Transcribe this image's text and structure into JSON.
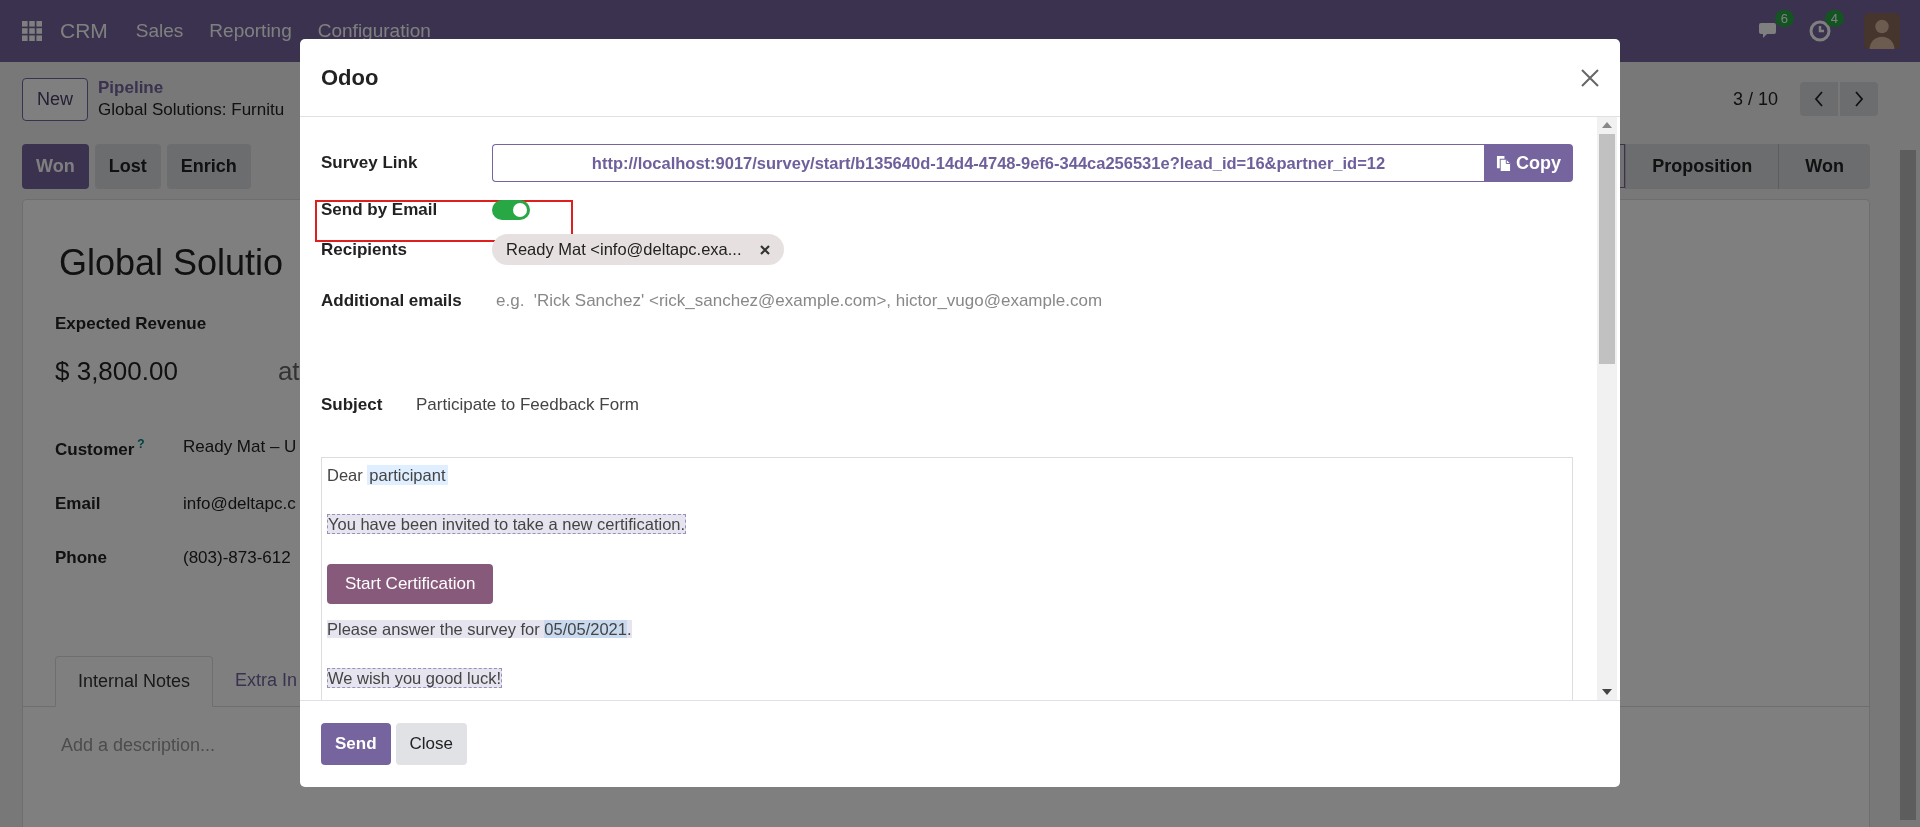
{
  "navbar": {
    "app": "CRM",
    "menus": [
      "Sales",
      "Reporting",
      "Configuration"
    ],
    "messages_count": "6",
    "activities_count": "4"
  },
  "control_panel": {
    "new_button": "New",
    "breadcrumb": "Pipeline",
    "record_title": "Global Solutions: Furnitu",
    "pager": "3 / 10"
  },
  "actions": [
    {
      "label": "Won",
      "primary": true
    },
    {
      "label": "Lost",
      "primary": false
    },
    {
      "label": "Enrich",
      "primary": false
    }
  ],
  "stages": [
    {
      "label": "Proposition",
      "selected": false
    },
    {
      "label": "Won",
      "selected": false
    }
  ],
  "record": {
    "title": "Global Solutio",
    "revenue_label": "Expected Revenue",
    "revenue": "$ 3,800.00",
    "revenue_suffix": "at",
    "fields": [
      {
        "label": "Customer",
        "help": "?",
        "value": "Ready Mat – U"
      },
      {
        "label": "Email",
        "value": "info@deltapc.c"
      },
      {
        "label": "Phone",
        "value": "(803)-873-612"
      }
    ],
    "tabs": [
      {
        "label": "Internal Notes",
        "selected": true
      },
      {
        "label": "Extra In",
        "selected": false
      }
    ],
    "description_placeholder": "Add a description..."
  },
  "dialog": {
    "title": "Odoo",
    "survey_link": {
      "label": "Survey Link",
      "value": "http://localhost:9017/survey/start/b135640d-14d4-4748-9ef6-344ca256531e?lead_id=16&partner_id=12",
      "copy": "Copy"
    },
    "send_by_email": {
      "label": "Send by Email",
      "on": true
    },
    "recipients": {
      "label": "Recipients",
      "tags": [
        "Ready Mat <info@deltapc.exa..."
      ]
    },
    "additional_emails": {
      "label": "Additional emails",
      "placeholder": "e.g.  'Rick Sanchez' <rick_sanchez@example.com>, hictor_vugo@example.com"
    },
    "subject": {
      "label": "Subject",
      "value": "Participate to Feedback Form"
    },
    "body": {
      "greeting": "Dear",
      "greeting_field": "participant",
      "invitation": "You have been invited to take a new certification.",
      "start_button": "Start Certification",
      "deadline": "Please answer the survey for",
      "deadline_field": "05/05/2021",
      "deadline_end": ".",
      "closing": "We wish you good luck!"
    },
    "buttons": [
      {
        "label": "Send",
        "primary": true
      },
      {
        "label": "Close",
        "primary": false
      }
    ]
  }
}
